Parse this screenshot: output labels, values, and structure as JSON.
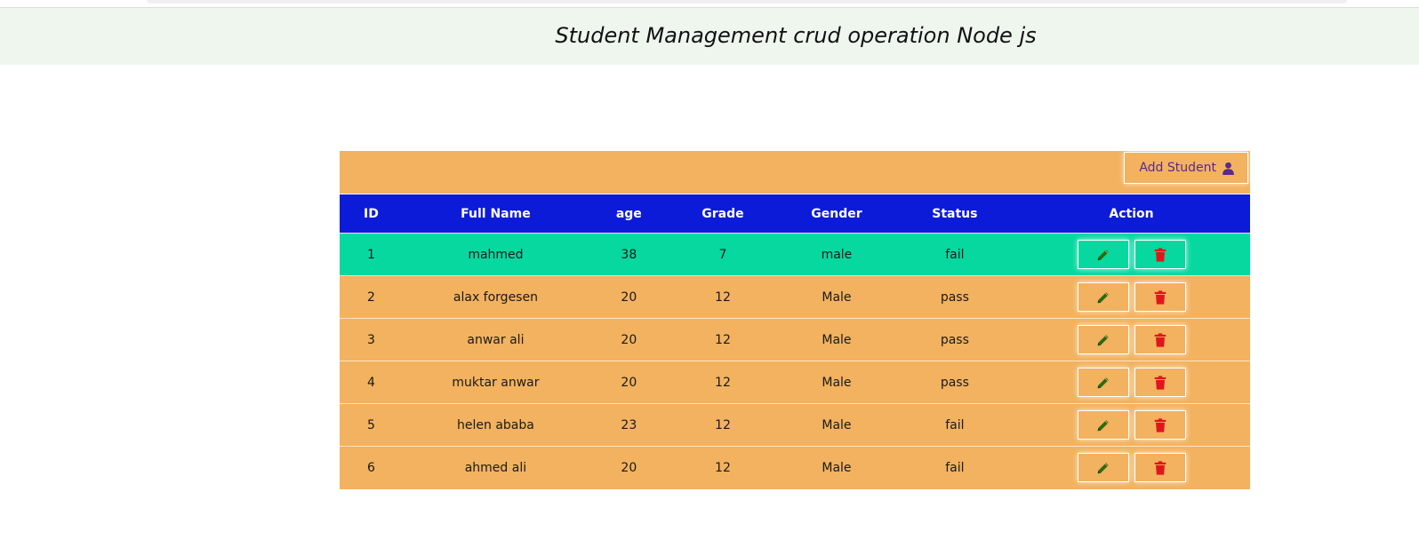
{
  "header": {
    "title": "Student Management crud operation Node js"
  },
  "toolbar": {
    "add_label": "Add Student"
  },
  "table": {
    "columns": [
      "ID",
      "Full Name",
      "age",
      "Grade",
      "Gender",
      "Status",
      "Action"
    ],
    "rows": [
      [
        "1",
        "mahmed",
        "38",
        "7",
        "male",
        "fail"
      ],
      [
        "2",
        "alax forgesen",
        "20",
        "12",
        "Male",
        "pass"
      ],
      [
        "3",
        "anwar ali",
        "20",
        "12",
        "Male",
        "pass"
      ],
      [
        "4",
        "muktar anwar",
        "20",
        "12",
        "Male",
        "pass"
      ],
      [
        "5",
        "helen ababa",
        "23",
        "12",
        "Male",
        "fail"
      ],
      [
        "6",
        "ahmed ali",
        "20",
        "12",
        "Male",
        "fail"
      ]
    ]
  },
  "icons": {
    "add": "user-icon",
    "edit": "pencil-icon",
    "delete": "trash-icon"
  },
  "colors": {
    "header_banner": "#eef6ee",
    "table_bg": "#f2b25f",
    "table_head": "#0c1bd8",
    "highlight_row": "#06d8a0",
    "edit_icon": "#2e6a12",
    "delete_icon": "#e0161c",
    "add_text": "#5a2a8c"
  }
}
